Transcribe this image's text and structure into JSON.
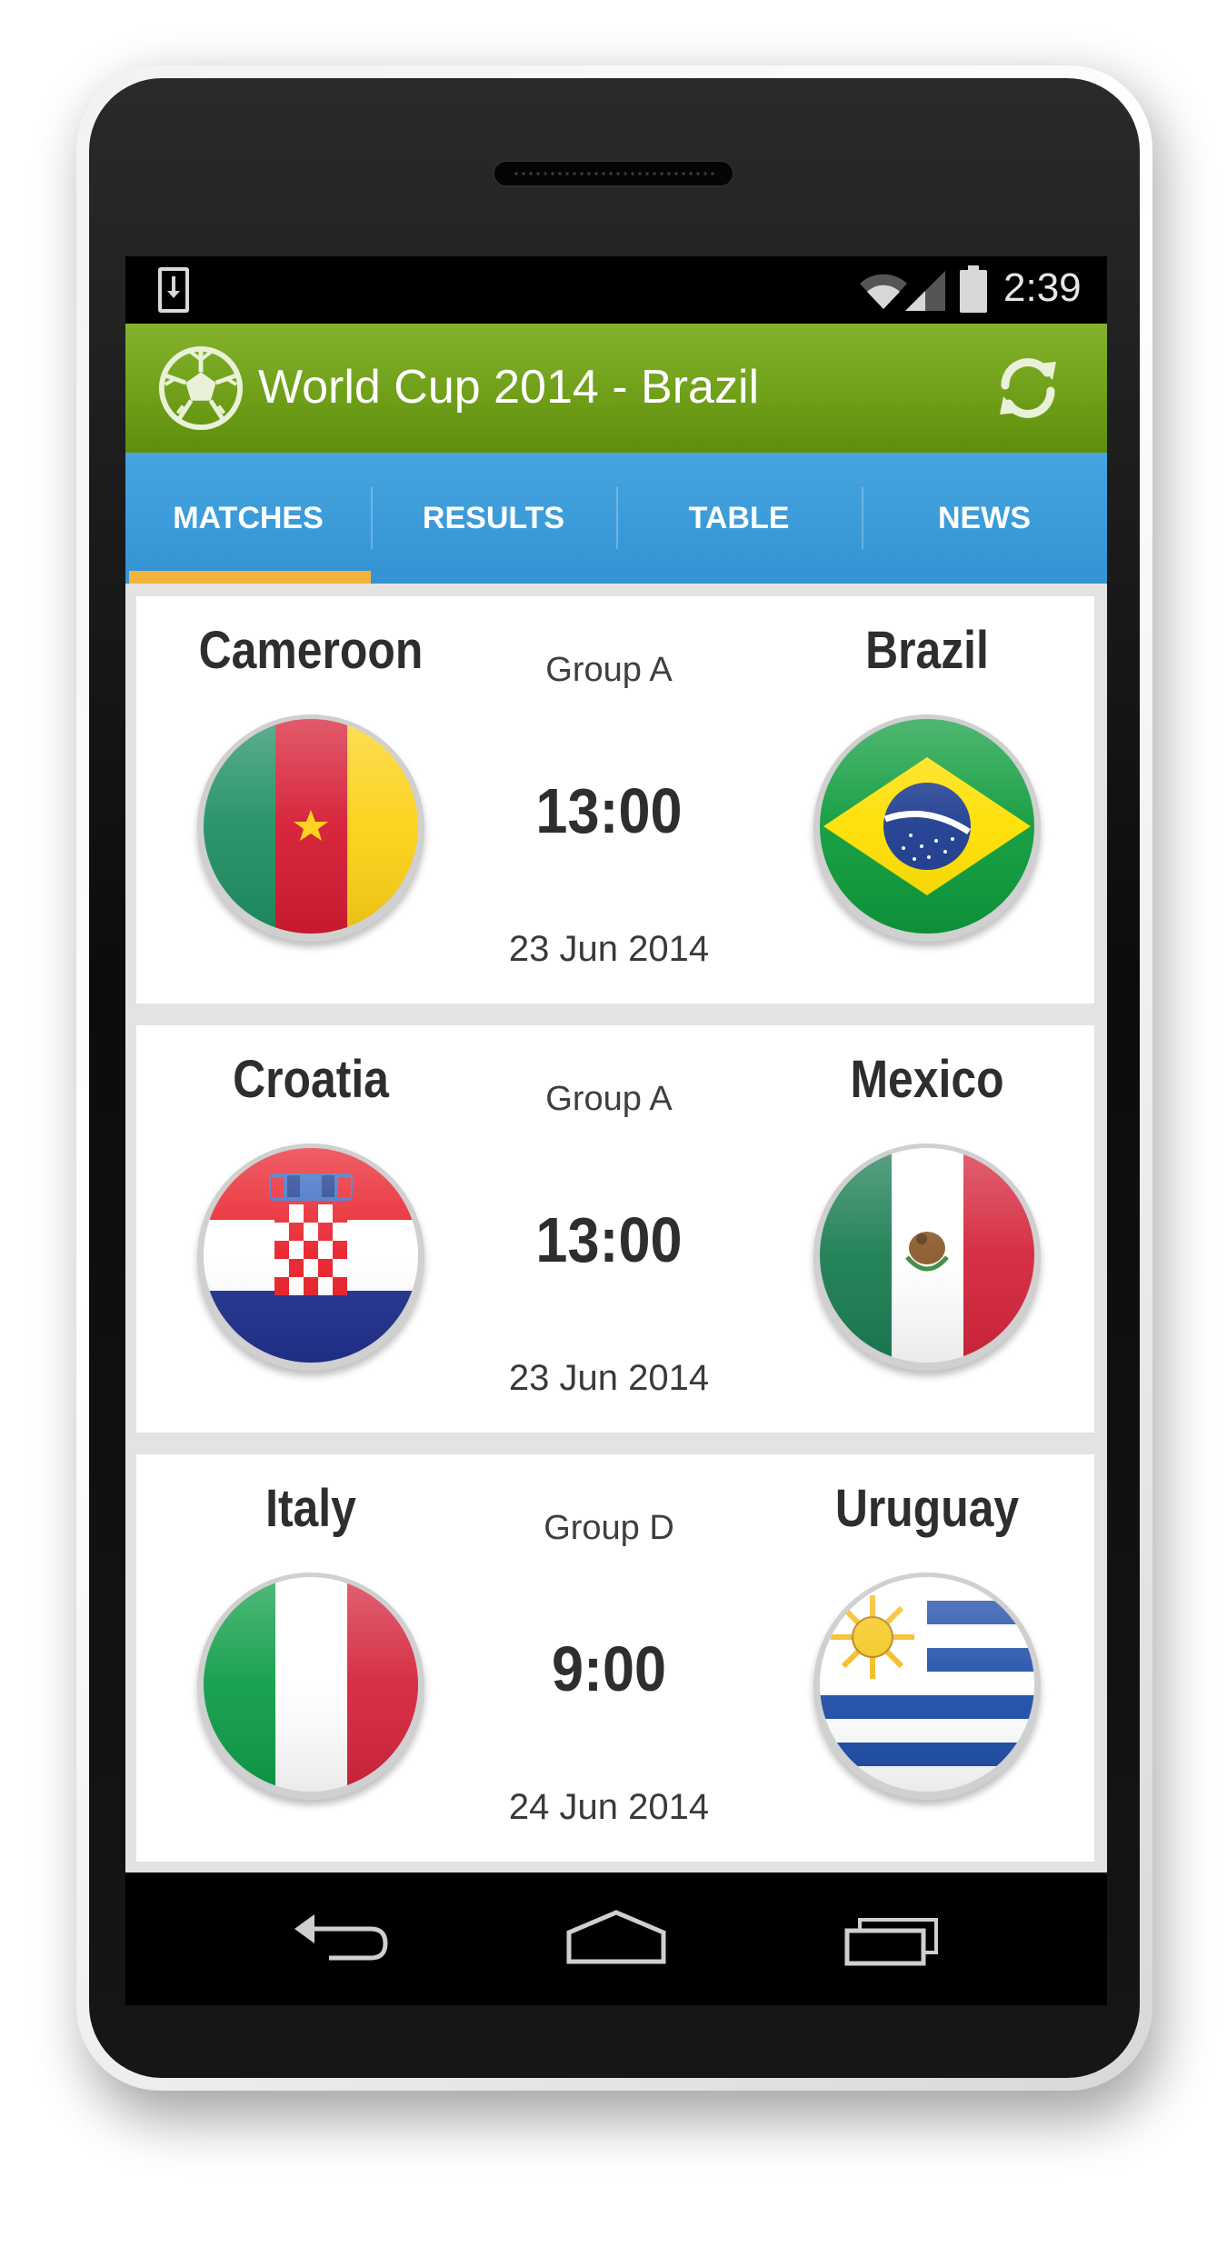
{
  "status_bar": {
    "time": "2:39"
  },
  "app": {
    "title": "World Cup 2014 - Brazil"
  },
  "tabs": [
    {
      "label": "MATCHES",
      "active": true
    },
    {
      "label": "RESULTS",
      "active": false
    },
    {
      "label": "TABLE",
      "active": false
    },
    {
      "label": "NEWS",
      "active": false
    }
  ],
  "matches": [
    {
      "home": "Cameroon",
      "away": "Brazil",
      "group": "Group A",
      "time": "13:00",
      "date": "23 Jun 2014"
    },
    {
      "home": "Croatia",
      "away": "Mexico",
      "group": "Group A",
      "time": "13:00",
      "date": "23 Jun 2014"
    },
    {
      "home": "Italy",
      "away": "Uruguay",
      "group": "Group D",
      "time": "9:00",
      "date": "24 Jun 2014"
    }
  ],
  "icons": {
    "status": [
      "download-icon",
      "wifi-icon",
      "signal-icon",
      "battery-icon"
    ],
    "action_bar": [
      "soccer-ball-icon",
      "refresh-icon"
    ],
    "navigation": [
      "back-icon",
      "home-icon",
      "recent-apps-icon"
    ]
  },
  "colors": {
    "action_bar": "#6e9e18",
    "tab_bar": "#3393d3",
    "tab_indicator": "#f3b43b",
    "card_bg": "#ffffff",
    "list_bg": "#e3e3e3"
  }
}
